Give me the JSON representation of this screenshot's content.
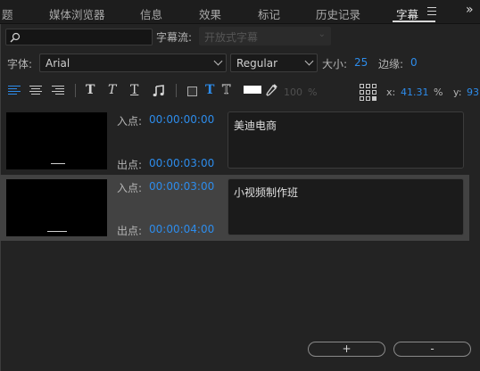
{
  "tabs": [
    {
      "label": "题",
      "active": false
    },
    {
      "label": "媒体浏览器",
      "active": false
    },
    {
      "label": "信息",
      "active": false
    },
    {
      "label": "效果",
      "active": false
    },
    {
      "label": "标记",
      "active": false
    },
    {
      "label": "历史记录",
      "active": false
    },
    {
      "label": "字幕",
      "active": true
    }
  ],
  "overflow_icon": "»",
  "search": {
    "value": "",
    "placeholder": ""
  },
  "caption_stream": {
    "label": "字幕流:",
    "value": "开放式字幕"
  },
  "font": {
    "label": "字体:",
    "family": "Arial",
    "style": "Regular",
    "size_label": "大小:",
    "size": "25",
    "edge_label": "边缘:",
    "edge": "0"
  },
  "format": {
    "opacity": "100",
    "opacity_unit": "%",
    "x_label": "x:",
    "x_value": "41.31",
    "x_unit": "%",
    "y_label": "y:",
    "y_value": "93",
    "fill_color": "#ffffff",
    "accent_color": "#2d8ceb"
  },
  "captions": [
    {
      "in_label": "入点:",
      "in": "00:00:00:00",
      "out_label": "出点:",
      "out": "00:00:03:00",
      "text": "美迪电商",
      "selected": false
    },
    {
      "in_label": "入点:",
      "in": "00:00:03:00",
      "out_label": "出点:",
      "out": "00:00:04:00",
      "text": "小视频制作班",
      "selected": true
    }
  ],
  "buttons": {
    "add": "+",
    "remove": "-"
  }
}
